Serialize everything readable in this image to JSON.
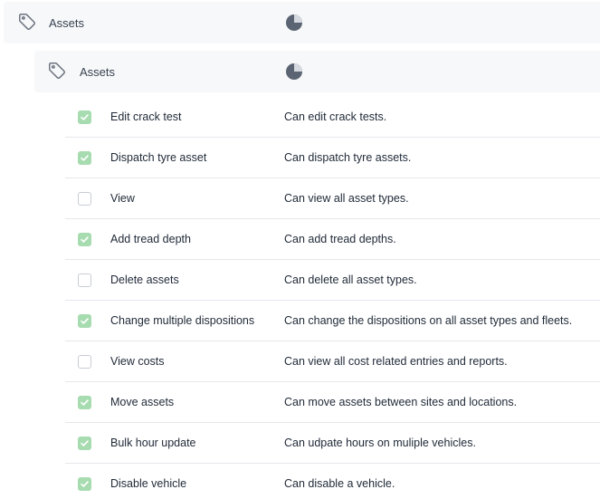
{
  "groups": [
    {
      "label": "Assets",
      "tag_icon": "tag-icon",
      "status_icon": "pie-chart-icon"
    },
    {
      "label": "Assets",
      "tag_icon": "tag-icon",
      "status_icon": "pie-chart-icon"
    }
  ],
  "permissions": [
    {
      "name": "Edit crack test",
      "description": "Can edit crack tests.",
      "checked": true
    },
    {
      "name": "Dispatch tyre asset",
      "description": "Can dispatch tyre assets.",
      "checked": true
    },
    {
      "name": "View",
      "description": "Can view all asset types.",
      "checked": false
    },
    {
      "name": "Add tread depth",
      "description": "Can add tread depths.",
      "checked": true
    },
    {
      "name": "Delete assets",
      "description": "Can delete all asset types.",
      "checked": false
    },
    {
      "name": "Change multiple dispositions",
      "description": "Can change the dispositions on all asset types and fleets.",
      "checked": true
    },
    {
      "name": "View costs",
      "description": "Can view all cost related entries and reports.",
      "checked": false
    },
    {
      "name": "Move assets",
      "description": "Can move assets between sites and locations.",
      "checked": true
    },
    {
      "name": "Bulk hour update",
      "description": "Can udpate hours on muliple vehicles.",
      "checked": true
    },
    {
      "name": "Disable vehicle",
      "description": "Can disable a vehicle.",
      "checked": true
    }
  ],
  "colors": {
    "checked_fill": "#a7dbb0",
    "unchecked_border": "#c7ccd3",
    "group_background": "#f7f8f9",
    "icon_gray": "#6b7280",
    "pie_dark": "#5b6472"
  }
}
